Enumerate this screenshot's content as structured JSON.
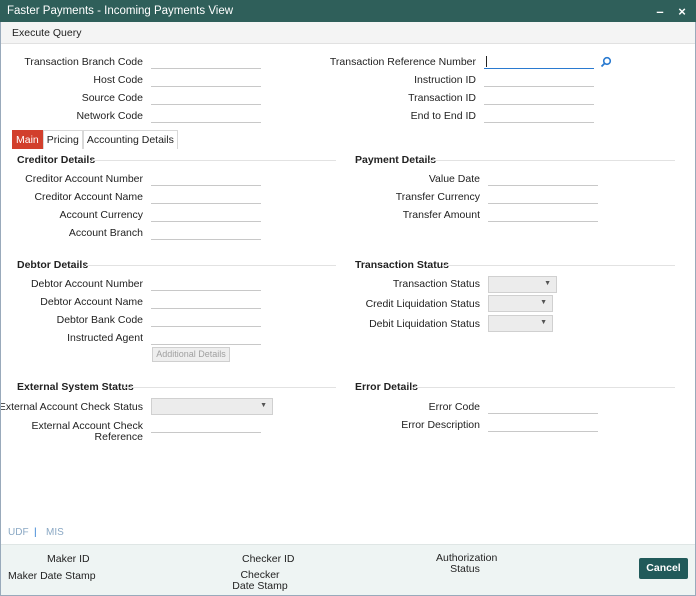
{
  "window": {
    "title": "Faster Payments - Incoming Payments View",
    "minimize": "–",
    "close": "×"
  },
  "toolbar": {
    "execute_query": "Execute Query"
  },
  "header_fields": {
    "txn_branch_code": "Transaction Branch Code",
    "host_code": "Host Code",
    "source_code": "Source Code",
    "network_code": "Network Code",
    "txn_ref_no": "Transaction Reference Number",
    "instruction_id": "Instruction ID",
    "transaction_id": "Transaction ID",
    "end_to_end_id": "End to End ID"
  },
  "tabs": {
    "main": "Main",
    "pricing": "Pricing",
    "accounting": "Accounting Details"
  },
  "creditor": {
    "title": "Creditor Details",
    "account_number": "Creditor Account Number",
    "account_name": "Creditor Account Name",
    "account_currency": "Account Currency",
    "account_branch": "Account Branch"
  },
  "payment": {
    "title": "Payment Details",
    "value_date": "Value Date",
    "transfer_currency": "Transfer Currency",
    "transfer_amount": "Transfer Amount"
  },
  "debtor": {
    "title": "Debtor Details",
    "account_number": "Debtor Account Number",
    "account_name": "Debtor Account Name",
    "bank_code": "Debtor Bank Code",
    "instructed_agent": "Instructed Agent",
    "additional_details": "Additional Details"
  },
  "txn_status": {
    "title": "Transaction Status",
    "status": "Transaction Status",
    "credit_liq": "Credit Liquidation Status",
    "debit_liq": "Debit Liquidation Status"
  },
  "external": {
    "title": "External System Status",
    "acct_check_status": "External Account Check Status",
    "acct_check_ref": "External Account Check Reference"
  },
  "error": {
    "title": "Error Details",
    "code": "Error Code",
    "description": "Error Description"
  },
  "links": {
    "udf": "UDF",
    "sep": "|",
    "mis": "MIS"
  },
  "footer": {
    "maker_id": "Maker ID",
    "maker_date": "Maker Date Stamp",
    "checker_id": "Checker ID",
    "checker_date": "Checker Date Stamp",
    "auth_status": "Authorization Status",
    "cancel": "Cancel"
  },
  "select_arrow": "▼"
}
